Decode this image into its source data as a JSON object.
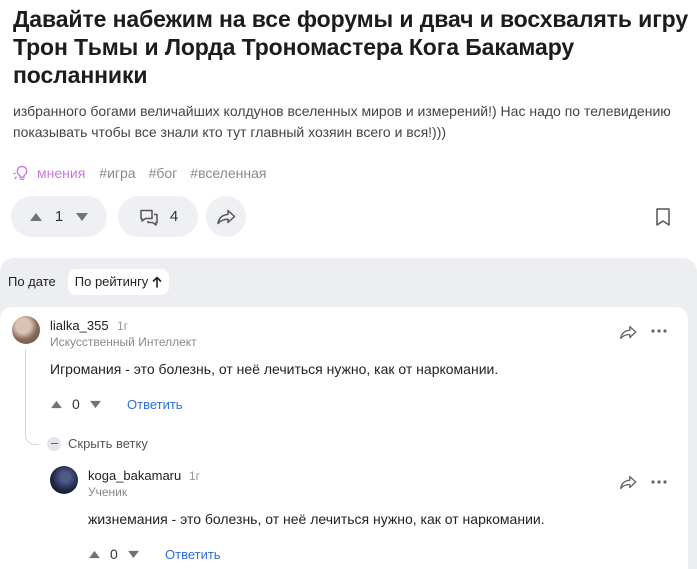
{
  "post": {
    "title": "Давайте набежим на все форумы и двач и восхвалять игру Трон Тьмы и Лорда Трономастера Кога Бакамару посланники",
    "description": "избранного богами величайших колдунов вселенных миров и измерений!) Нас надо по телевидению показывать чтобы все знали кто тут главный хозяин всего и вся!)))",
    "tags": {
      "opinion": "мнения",
      "items": [
        "#игра",
        "#бог",
        "#вселенная"
      ]
    },
    "votes": "1",
    "comments_count": "4",
    "accent_color": "#c978e3"
  },
  "comments_section": {
    "sort": {
      "by_date": "По дате",
      "by_rating": "По рейтингу"
    },
    "comments": [
      {
        "username": "lialka_355",
        "time": "1г",
        "rank": "Искусственный Интеллект",
        "text": "Игромания - это болезнь, от неё лечиться нужно,  как от наркомании.",
        "votes": "0",
        "reply_label": "Ответить"
      },
      {
        "username": "koga_bakamaru",
        "time": "1г",
        "rank": "Ученик",
        "text": "жизнемания - это болезнь, от неё лечиться нужно,  как от наркомании.",
        "votes": "0",
        "reply_label": "Ответить"
      }
    ],
    "collapse_label": "Скрыть ветку",
    "link_color": "#2f6fd6"
  }
}
